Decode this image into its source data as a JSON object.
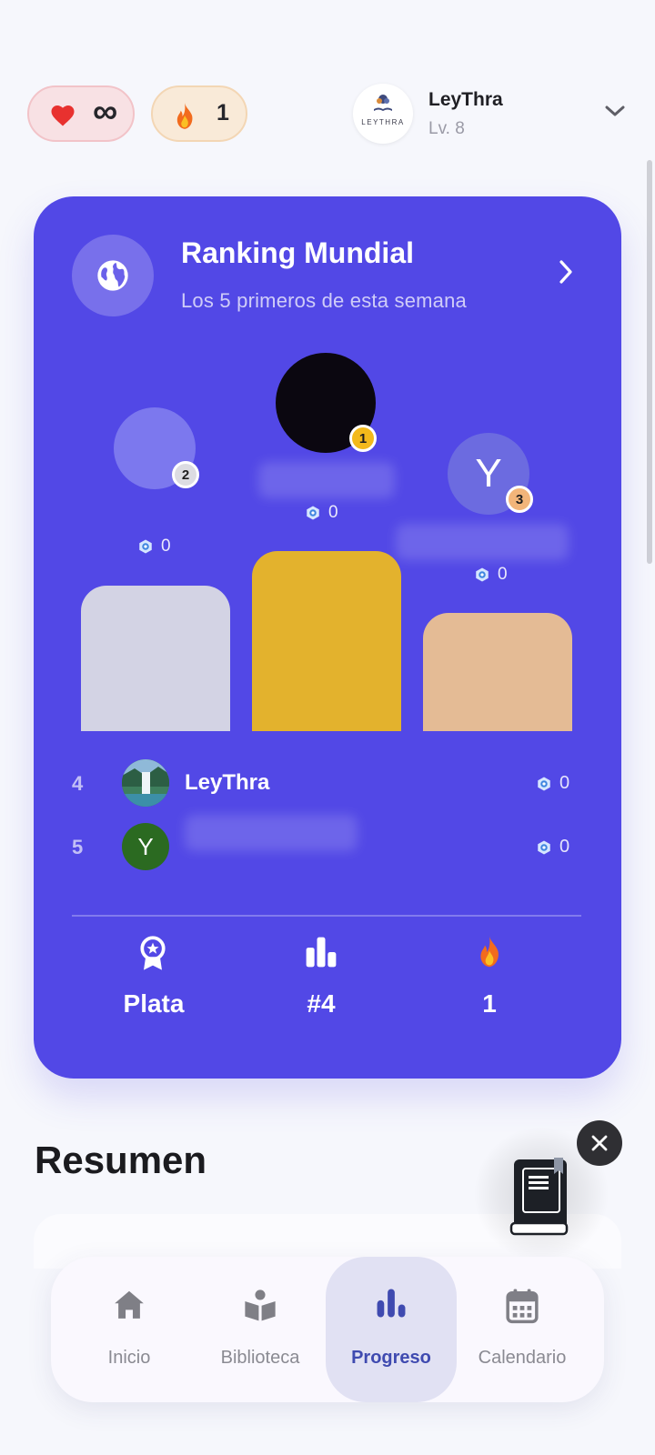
{
  "top_bar": {
    "lives_value": "∞",
    "streak_value": "1",
    "profile_name": "LeyThra",
    "profile_level": "Lv. 8",
    "logo_text": "LEYTHRA"
  },
  "ranking": {
    "title": "Ranking Mundial",
    "subtitle": "Los 5 primeros de esta semana",
    "podium": [
      {
        "position": "1",
        "score": "0"
      },
      {
        "position": "2",
        "score": "0"
      },
      {
        "position": "3",
        "score": "0",
        "initial": "Y"
      }
    ],
    "list": [
      {
        "rank": "4",
        "name": "LeyThra",
        "score": "0"
      },
      {
        "rank": "5",
        "name": "",
        "initial": "Y",
        "score": "0"
      }
    ],
    "stats": [
      {
        "icon": "medal-icon",
        "value": "Plata"
      },
      {
        "icon": "bar-chart-icon",
        "value": "#4"
      },
      {
        "icon": "fire-icon",
        "value": "1"
      }
    ]
  },
  "summary": {
    "title": "Resumen"
  },
  "nav": {
    "items": [
      {
        "label": "Inicio",
        "icon": "home-icon"
      },
      {
        "label": "Biblioteca",
        "icon": "library-icon"
      },
      {
        "label": "Progreso",
        "icon": "progress-icon"
      },
      {
        "label": "Calendario",
        "icon": "calendar-icon"
      }
    ],
    "active": "Progreso"
  },
  "colors": {
    "card": "#5248e6",
    "gold": "#e3b22d",
    "silver": "#d3d3e4",
    "bronze": "#e4bb95",
    "active_nav": "#3f4ab0"
  }
}
